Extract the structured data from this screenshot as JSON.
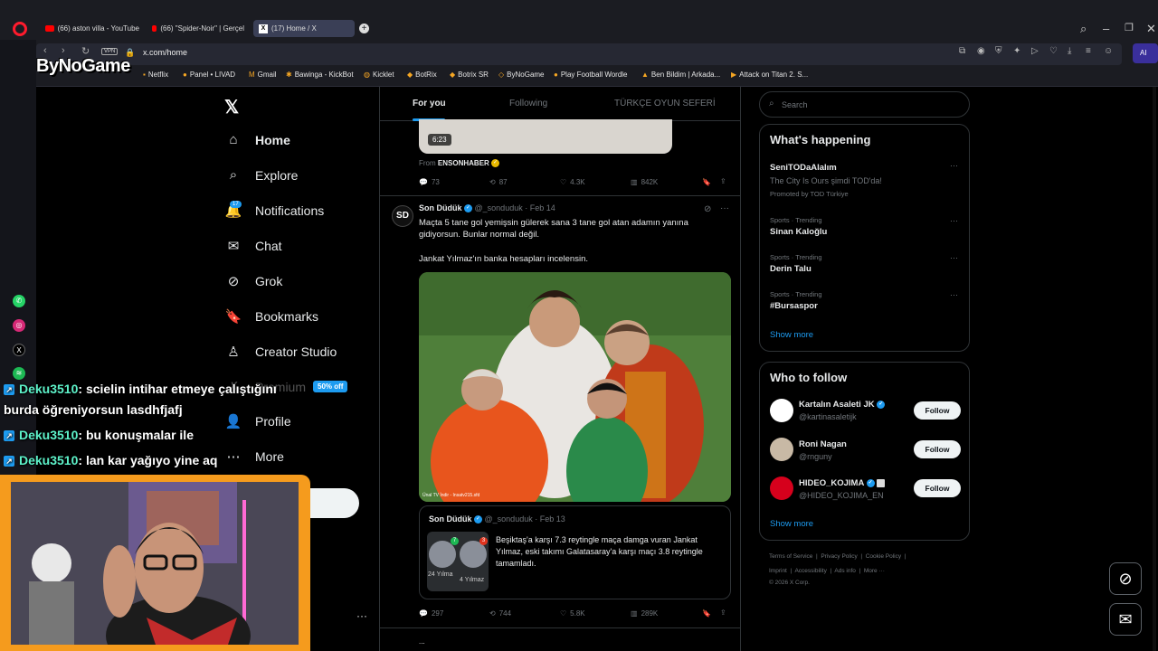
{
  "browser": {
    "tabs": [
      {
        "label": "(66) aston villa - YouTube",
        "kind": "yt"
      },
      {
        "label": "(66) \"Spider-Noir\" | Gerçel",
        "kind": "yt"
      },
      {
        "label": "(17) Home / X",
        "kind": "x"
      }
    ],
    "vpn_label": "VPN",
    "url": "x.com/home",
    "ai_label": "AI",
    "bookmarks": [
      "Netflix",
      "Panel • LIVAD",
      "Gmail",
      "Bawinga - KickBot",
      "Kicklet",
      "BotRix",
      "Botrix SR",
      "ByNoGame",
      "Play Football Wordle",
      "Ben Bildim | Arkada...",
      "Attack on Titan 2. S..."
    ]
  },
  "overlay": {
    "brand": "ByNoGame",
    "chat": [
      {
        "user": "Deku3510",
        "msg": ": scielin intihar etmeye çalıştığını",
        "cont": "burda öğreniyorsun lasdhfjafj"
      },
      {
        "user": "Deku3510",
        "msg": ": bu konuşmalar ile"
      },
      {
        "user": "Deku3510",
        "msg": ": lan kar yağıyo yine aq"
      }
    ]
  },
  "nav": {
    "logo": "𝕏",
    "notif_count": "17",
    "items": [
      {
        "icon": "⌂",
        "label": "Home",
        "name": "home"
      },
      {
        "icon": "⌕",
        "label": "Explore",
        "name": "explore"
      },
      {
        "icon": "🔔",
        "label": "Notifications",
        "name": "notifications"
      },
      {
        "icon": "✉",
        "label": "Chat",
        "name": "chat"
      },
      {
        "icon": "⊘",
        "label": "Grok",
        "name": "grok"
      },
      {
        "icon": "🔖",
        "label": "Bookmarks",
        "name": "bookmarks"
      },
      {
        "icon": "♙",
        "label": "Creator Studio",
        "name": "creator-studio"
      },
      {
        "icon": "✗",
        "label": "Premium",
        "name": "premium"
      },
      {
        "icon": "👤",
        "label": "Profile",
        "name": "profile"
      },
      {
        "icon": "⋯",
        "label": "More",
        "name": "more"
      }
    ],
    "premium_badge": "50% off"
  },
  "timeline": {
    "tabs": [
      "For you",
      "Following",
      "TÜRKÇE OYUN SEFERİ"
    ],
    "prev_post": {
      "duration": "6:23",
      "from_label": "From",
      "from_source": "ENSONHABER",
      "replies": "73",
      "reposts": "87",
      "likes": "4.3K",
      "views": "842K"
    },
    "post": {
      "name": "Son Düdük",
      "handle": "@_sonduduk",
      "date": "· Feb 14",
      "avatar_text": "SD",
      "text1": "Maçta 5 tane gol yemişsin gülerek sana 3 tane gol atan adamın yanına gidiyorsun. Bunlar normal değil.",
      "text2": "Jankat Yılmaz'ın banka hesapları incelensin.",
      "watermark": "Ünal TV İndir - Insatv215.sfd",
      "quote": {
        "name": "Son Düdük",
        "handle": "@_sonduduk",
        "date": "· Feb 13",
        "text": "Beşiktaş'a karşı 7.3 reytingle maça damga vuran Jankat Yılmaz, eski takımı Galatasaray'a karşı maçı 3.8 reytingle tamamladı.",
        "thumb_left": "24 Yılma",
        "thumb_right": "4 Yılmaz",
        "rating_left": "7",
        "rating_right": "3"
      },
      "replies": "297",
      "reposts": "744",
      "likes": "5.8K",
      "views": "289K"
    },
    "next_post_cut": "..."
  },
  "right": {
    "search_placeholder": "Search",
    "whats_happening": "What's happening",
    "trends": [
      {
        "meta": "",
        "title": "SeniTODaAlalım",
        "sub": "The City Is Ours şimdi TOD'da!",
        "promo": "Promoted by TOD Türkiye"
      },
      {
        "meta": "Sports · Trending",
        "title": "Sinan Kaloğlu"
      },
      {
        "meta": "Sports · Trending",
        "title": "Derin Talu"
      },
      {
        "meta": "Sports · Trending",
        "title": "#Bursaspor"
      }
    ],
    "show_more": "Show more",
    "who_to_follow": "Who to follow",
    "follow_label": "Follow",
    "accounts": [
      {
        "name": "Kartalın Asaleti JK",
        "handle": "@kartinasaletijk"
      },
      {
        "name": "Roni Nagan",
        "handle": "@rnguny"
      },
      {
        "name": "HIDEO_KOJIMA",
        "handle": "@HIDEO_KOJIMA_EN"
      }
    ],
    "footer1": [
      "Terms of Service",
      "Privacy Policy",
      "Cookie Policy"
    ],
    "footer2": [
      "Imprint",
      "Accessibility",
      "Ads info",
      "More ···"
    ],
    "copyright": "© 2026 X Corp."
  },
  "colors": {
    "accent": "#1d9bf0",
    "bg": "#000000",
    "border": "#2f3336",
    "muted": "#71767b",
    "overlay_frame": "#f59b1d"
  }
}
